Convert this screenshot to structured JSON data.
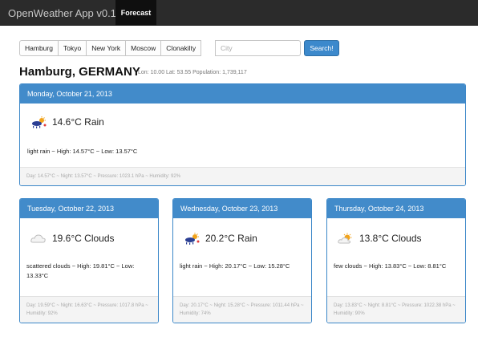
{
  "app": {
    "title": "OpenWeather App v0.1.0",
    "nav_forecast": "Forecast"
  },
  "cities": [
    "Hamburg",
    "Tokyo",
    "New York",
    "Moscow",
    "Clonakilty"
  ],
  "search": {
    "placeholder": "City",
    "button_label": "Search!"
  },
  "location": {
    "title": "Hamburg, GERMANY",
    "meta": "Lon: 10.00 Lat: 53.55 Population: 1,739,117"
  },
  "today": {
    "date": "Monday, October 21, 2013",
    "temp_text": "14.6°C Rain",
    "icon": "rain-icon",
    "summary": "light rain ~ High: 14.57°C ~ Low: 13.57°C",
    "footer": "Day: 14.57°C ~ Night: 13.57°C ~ Pressure: 1023.1 hPa ~ Humidity: 92%"
  },
  "forecast": [
    {
      "date": "Tuesday, October 22, 2013",
      "temp_text": "19.6°C Clouds",
      "icon": "cloud-icon",
      "summary": "scattered clouds ~ High: 19.81°C ~ Low: 13.33°C",
      "footer": "Day: 19.59°C ~ Night: 16.63°C ~ Pressure: 1017.8 hPa ~ Humidity: 92%"
    },
    {
      "date": "Wednesday, October 23, 2013",
      "temp_text": "20.2°C Rain",
      "icon": "rain-icon",
      "summary": "light rain ~ High: 20.17°C ~ Low: 15.28°C",
      "footer": "Day: 20.17°C ~ Night: 15.28°C ~ Pressure: 1011.44 hPa ~ Humidity: 74%"
    },
    {
      "date": "Thursday, October 24, 2013",
      "temp_text": "13.8°C Clouds",
      "icon": "sun-cloud-icon",
      "summary": "few clouds ~ High: 13.83°C ~ Low: 8.81°C",
      "footer": "Day: 13.83°C ~ Night: 8.81°C ~ Pressure: 1022.38 hPa ~ Humidity: 90%"
    }
  ],
  "colors": {
    "navbar": "#2b2b2b",
    "accent": "#428bca",
    "search_button": "#3c89cc"
  }
}
